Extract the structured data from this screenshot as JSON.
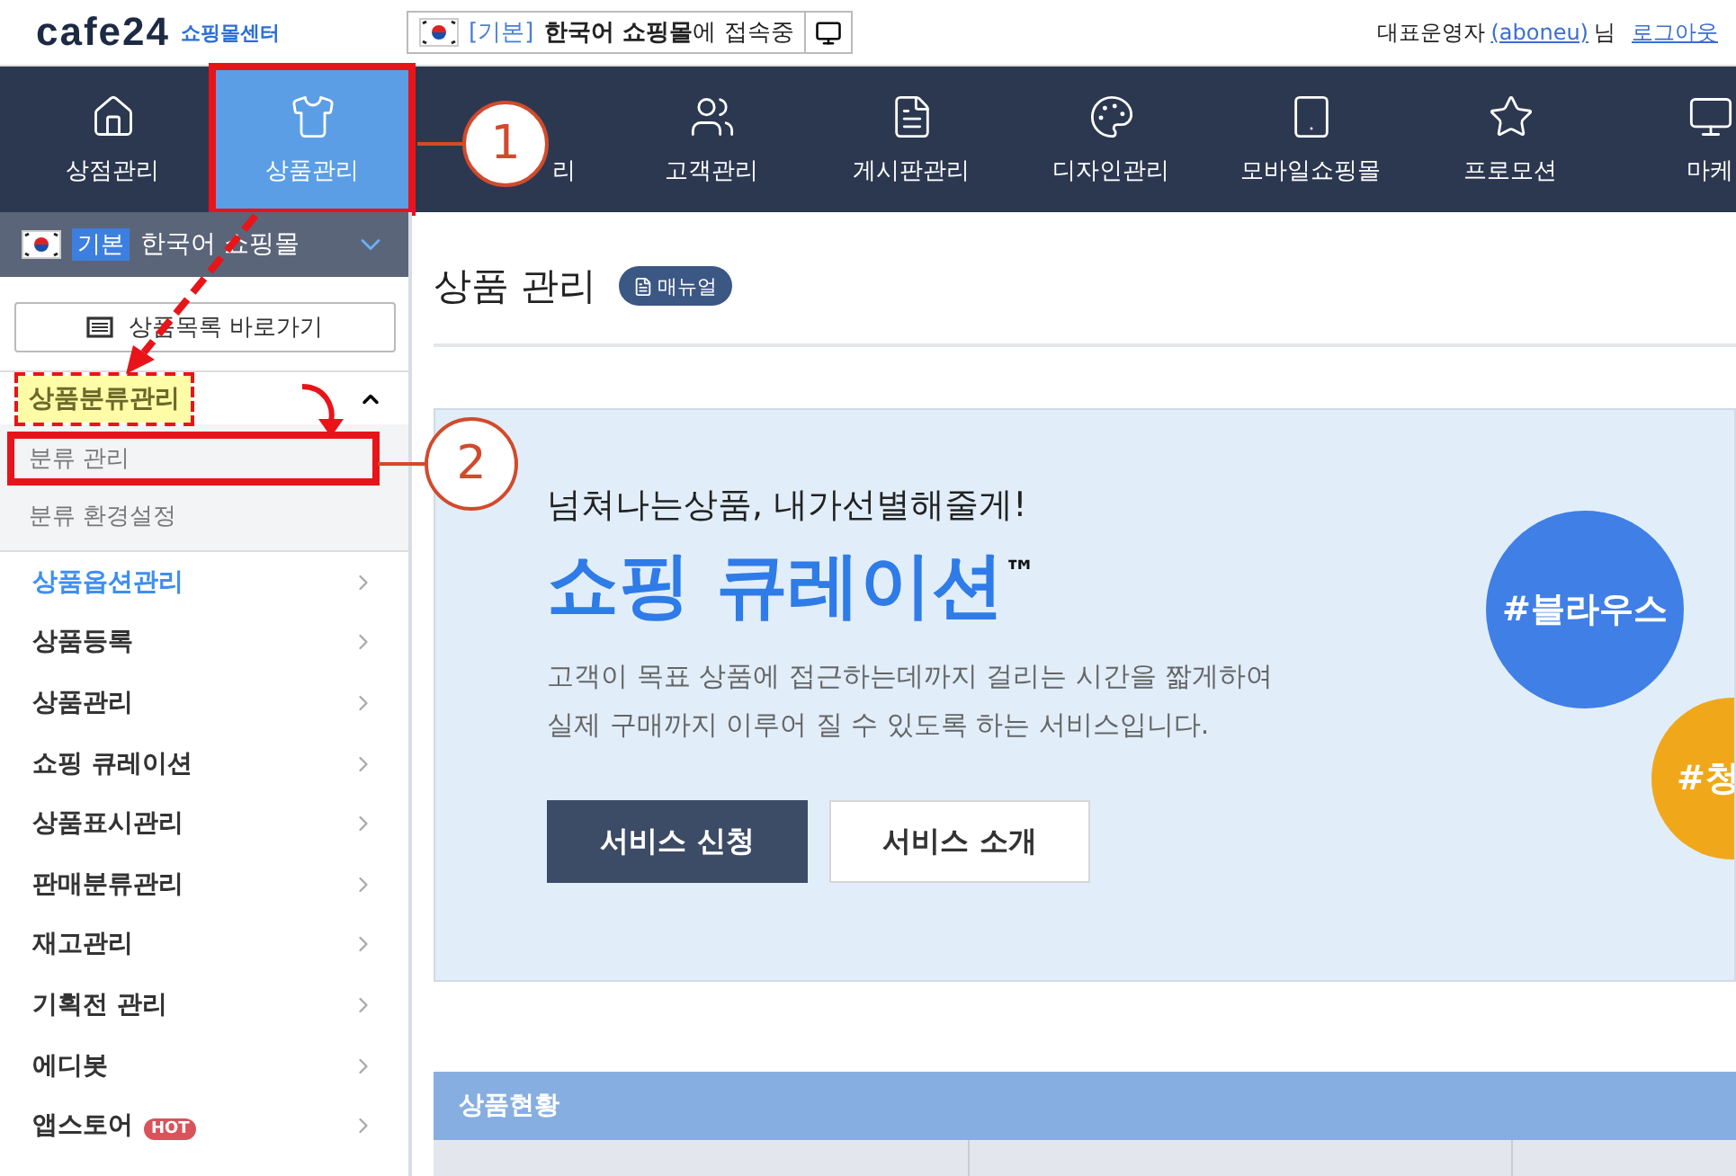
{
  "header": {
    "logo": "cafe24",
    "logo_sub": "쇼핑몰센터",
    "shop_badge": "[기본]",
    "shop_name": "한국어 쇼핑몰",
    "shop_suffix": "에 접속중",
    "user_role": "대표운영자",
    "user_id": "(aboneu)",
    "user_suffix": "님",
    "logout": "로그아웃"
  },
  "nav": [
    {
      "label": "상점관리",
      "selected": false,
      "highlighted": false
    },
    {
      "label": "상품관리",
      "selected": true,
      "highlighted": true
    },
    {
      "label": "리",
      "selected": false,
      "highlighted": false
    },
    {
      "label": "고객관리",
      "selected": false,
      "highlighted": false
    },
    {
      "label": "게시판관리",
      "selected": false,
      "highlighted": false
    },
    {
      "label": "디자인관리",
      "selected": false,
      "highlighted": false
    },
    {
      "label": "모바일쇼핑몰",
      "selected": false,
      "highlighted": false
    },
    {
      "label": "프로모션",
      "selected": false,
      "highlighted": false
    },
    {
      "label": "마케",
      "selected": false,
      "highlighted": false
    }
  ],
  "sidebar": {
    "shop": {
      "badge": "기본",
      "name": "한국어 쇼핑몰"
    },
    "shortcut": "상품목록 바로가기",
    "group": {
      "label": "상품분류관리",
      "expanded": true,
      "marked": true,
      "children": [
        {
          "label": "분류 관리",
          "highlighted": true
        },
        {
          "label": "분류 환경설정",
          "highlighted": false
        }
      ]
    },
    "items": [
      {
        "label": "상품옵션관리",
        "selected": true
      },
      {
        "label": "상품등록",
        "selected": false
      },
      {
        "label": "상품관리",
        "selected": false
      },
      {
        "label": "쇼핑 큐레이션",
        "selected": false
      },
      {
        "label": "상품표시관리",
        "selected": false
      },
      {
        "label": "판매분류관리",
        "selected": false
      },
      {
        "label": "재고관리",
        "selected": false
      },
      {
        "label": "기획전 관리",
        "selected": false
      },
      {
        "label": "에디봇",
        "selected": false
      },
      {
        "label": "앱스토어",
        "selected": false,
        "badge": "HOT"
      }
    ]
  },
  "page": {
    "title": "상품 관리",
    "manual": "매뉴얼"
  },
  "banner": {
    "kicker": "넘쳐나는상품, 내가선별해줄게!",
    "title": "쇼핑 큐레이션",
    "title_mark": "™",
    "description": [
      "고객이 목표 상품에 접근하는데까지 걸리는 시간을 짧게하여",
      "실제 구매까지 이루어 질 수 있도록 하는 서비스입니다."
    ],
    "buttons": [
      {
        "label": "서비스 신청",
        "primary": true
      },
      {
        "label": "서비스 소개",
        "primary": false
      }
    ],
    "tags": [
      {
        "label": "#블라우스",
        "color": "#3f7fe6"
      },
      {
        "label": "#청",
        "color": "#f0a81a"
      }
    ]
  },
  "status": {
    "title": "상품현황"
  },
  "callouts": [
    {
      "number": "1"
    },
    {
      "number": "2"
    }
  ]
}
